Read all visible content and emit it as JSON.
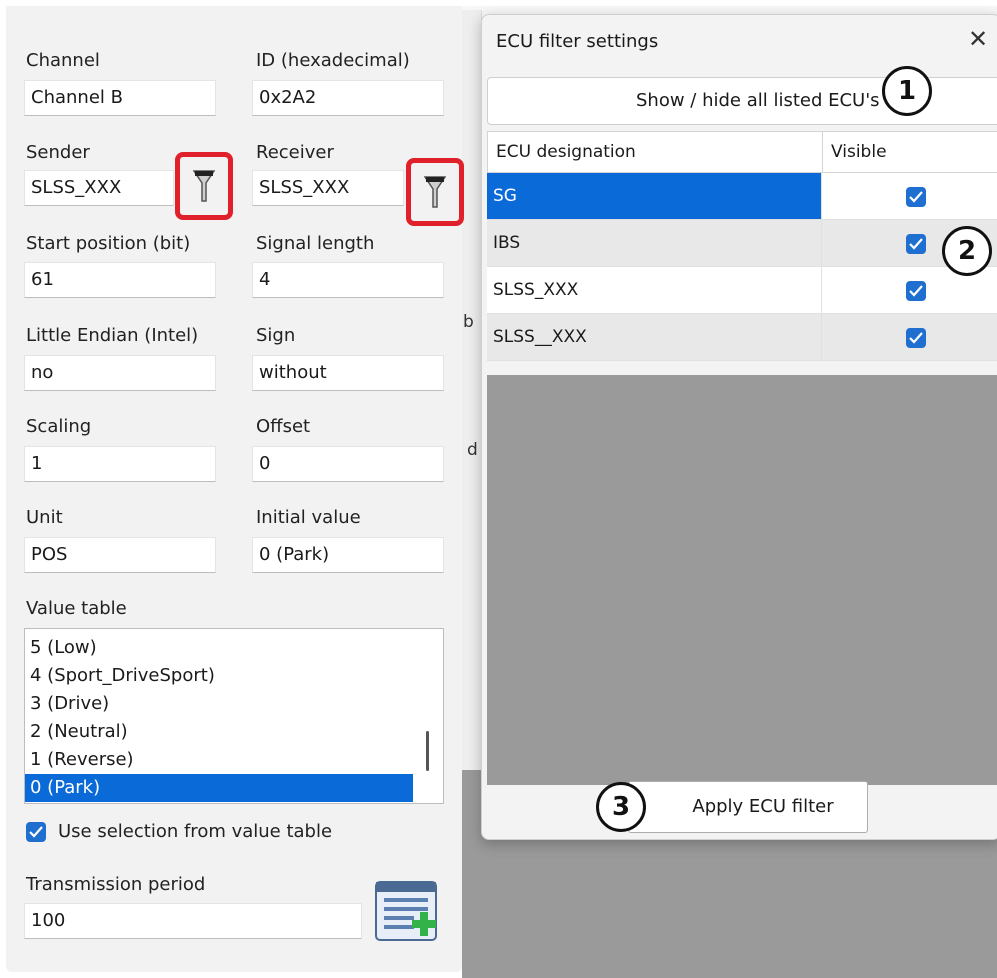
{
  "signal_form": {
    "channel": {
      "label": "Channel",
      "value": "Channel B"
    },
    "id_hex": {
      "label": "ID (hexadecimal)",
      "value": "0x2A2"
    },
    "sender": {
      "label": "Sender",
      "value": "SLSS_XXX"
    },
    "receiver": {
      "label": "Receiver",
      "value": "SLSS_XXX"
    },
    "start_position": {
      "label": "Start position (bit)",
      "value": "61"
    },
    "signal_length": {
      "label": "Signal length",
      "value": "4"
    },
    "little_endian": {
      "label": "Little Endian (Intel)",
      "value": "no"
    },
    "sign": {
      "label": "Sign",
      "value": "without"
    },
    "scaling": {
      "label": "Scaling",
      "value": "1"
    },
    "offset": {
      "label": "Offset",
      "value": "0"
    },
    "unit": {
      "label": "Unit",
      "value": "POS"
    },
    "initial_value": {
      "label": "Initial value",
      "value": "0  (Park)"
    },
    "value_table": {
      "label": "Value table",
      "items": [
        "5  (Low)",
        "4  (Sport_DriveSport)",
        "3  (Drive)",
        "2  (Neutral)",
        "1  (Reverse)",
        "0  (Park)"
      ],
      "selected": "0  (Park)"
    },
    "use_selection": {
      "label": "Use selection from value table",
      "checked": true
    },
    "transmission_period": {
      "label": "Transmission period",
      "value": "100"
    },
    "icons": {
      "filter": "filter-icon",
      "add_list": "add-list-icon"
    }
  },
  "background_fragments": [
    "b",
    "d"
  ],
  "ecu_dialog": {
    "title": "ECU filter settings",
    "close": "✕",
    "show_hide_button": "Show / hide all listed ECU's",
    "columns": [
      "ECU designation",
      "Visible"
    ],
    "rows": [
      {
        "name": "SG",
        "visible": true,
        "selected": true
      },
      {
        "name": "IBS",
        "visible": true,
        "selected": false
      },
      {
        "name": "SLSS_XXX",
        "visible": true,
        "selected": false
      },
      {
        "name": "SLSS__XXX",
        "visible": true,
        "selected": false
      }
    ],
    "apply_button": "Apply ECU filter"
  },
  "annotations": [
    "1",
    "2",
    "3"
  ],
  "colors": {
    "accent": "#0a6ad8",
    "highlight": "#e0202a",
    "checkbox": "#1f6fd1"
  }
}
